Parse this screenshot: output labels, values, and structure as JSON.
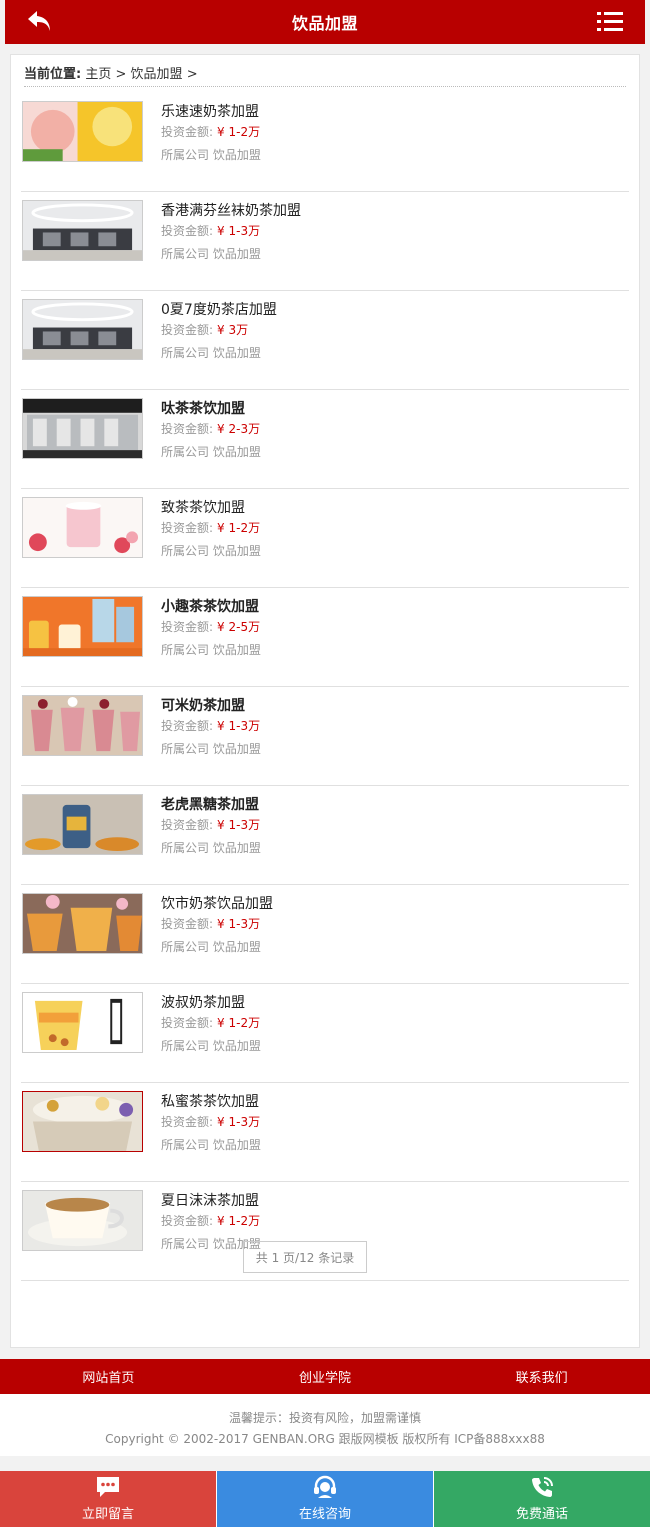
{
  "header": {
    "title": "饮品加盟",
    "back_icon": "back-arrow-icon",
    "menu_icon": "list-menu-icon"
  },
  "breadcrumb": {
    "label": "当前位置:",
    "home": "主页",
    "sep1": ">",
    "current": "饮品加盟",
    "sep2": ">"
  },
  "items": [
    {
      "name": "乐速速奶茶加盟",
      "invest_label": "投资金额:",
      "amount": "¥ 1-2万",
      "company": "所属公司 饮品加盟",
      "bold": false
    },
    {
      "name": "香港满芬丝袜奶茶加盟",
      "invest_label": "投资金额:",
      "amount": "¥ 1-3万",
      "company": "所属公司 饮品加盟",
      "bold": false
    },
    {
      "name": "0夏7度奶茶店加盟",
      "invest_label": "投资金额:",
      "amount": "¥ 3万",
      "company": "所属公司 饮品加盟",
      "bold": false
    },
    {
      "name": "呔茶茶饮加盟",
      "invest_label": "投资金额:",
      "amount": "¥ 2-3万",
      "company": "所属公司 饮品加盟",
      "bold": true
    },
    {
      "name": "致茶茶饮加盟",
      "invest_label": "投资金额:",
      "amount": "¥ 1-2万",
      "company": "所属公司 饮品加盟",
      "bold": false
    },
    {
      "name": "小趣茶茶饮加盟",
      "invest_label": "投资金额:",
      "amount": "¥ 2-5万",
      "company": "所属公司 饮品加盟",
      "bold": true
    },
    {
      "name": "可米奶茶加盟",
      "invest_label": "投资金额:",
      "amount": "¥ 1-3万",
      "company": "所属公司 饮品加盟",
      "bold": true
    },
    {
      "name": "老虎黑糖茶加盟",
      "invest_label": "投资金额:",
      "amount": "¥ 1-3万",
      "company": "所属公司 饮品加盟",
      "bold": true
    },
    {
      "name": "饮市奶茶饮品加盟",
      "invest_label": "投资金额:",
      "amount": "¥ 1-3万",
      "company": "所属公司 饮品加盟",
      "bold": false
    },
    {
      "name": "波叔奶茶加盟",
      "invest_label": "投资金额:",
      "amount": "¥ 1-2万",
      "company": "所属公司 饮品加盟",
      "bold": false
    },
    {
      "name": "私蜜茶茶饮加盟",
      "invest_label": "投资金额:",
      "amount": "¥ 1-3万",
      "company": "所属公司 饮品加盟",
      "bold": false
    },
    {
      "name": "夏日沫沫茶加盟",
      "invest_label": "投资金额:",
      "amount": "¥ 1-2万",
      "company": "所属公司 饮品加盟",
      "bold": false
    }
  ],
  "pager": {
    "text": "共 1 页/12 条记录"
  },
  "footer_nav": [
    {
      "label": "网站首页"
    },
    {
      "label": "创业学院"
    },
    {
      "label": "联系我们"
    }
  ],
  "footer_info": {
    "tip": "温馨提示：投资有风险，加盟需谨慎",
    "copyright": "Copyright © 2002-2017 GENBAN.ORG 跟版网模板 版权所有 ICP备888xxx88"
  },
  "bottom_bar": [
    {
      "label": "立即留言",
      "icon": "chat-bubble-icon",
      "color": "#d9443c"
    },
    {
      "label": "在线咨询",
      "icon": "headset-icon",
      "color": "#3a8be0"
    },
    {
      "label": "免费通话",
      "icon": "phone-icon",
      "color": "#34a864"
    }
  ],
  "colors": {
    "brand": "#b80000",
    "price": "#cc0000"
  }
}
